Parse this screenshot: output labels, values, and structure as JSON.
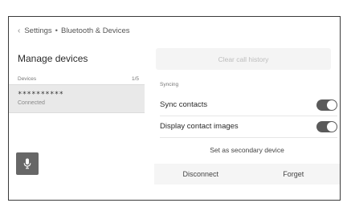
{
  "breadcrumb": {
    "back_icon": "chevron-left-icon",
    "items": [
      "Settings",
      "Bluetooth & Devices"
    ],
    "separator": "•"
  },
  "page_title": "Manage devices",
  "devices": {
    "header_label": "Devices",
    "count": "1/5",
    "list": [
      {
        "name": "**********",
        "status": "Connected"
      }
    ]
  },
  "mic_button": {
    "icon": "microphone-icon"
  },
  "actions": {
    "clear_call_history": "Clear call history",
    "set_secondary": "Set as secondary device",
    "disconnect": "Disconnect",
    "forget": "Forget"
  },
  "syncing": {
    "section_label": "Syncing",
    "sync_contacts": {
      "label": "Sync contacts",
      "enabled": true
    },
    "display_contact_images": {
      "label": "Display contact images",
      "enabled": true
    }
  },
  "colors": {
    "toggle_on": "#5a5a5a",
    "selected_row": "#e9e9e9",
    "mic_button": "#676767"
  }
}
